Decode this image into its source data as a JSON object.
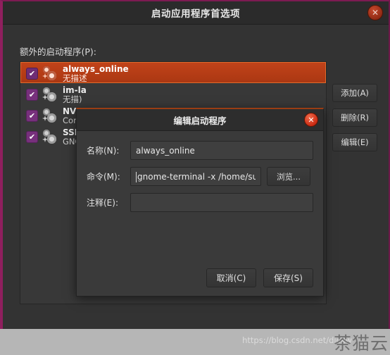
{
  "window": {
    "title": "启动应用程序首选项",
    "close_icon": "close-icon",
    "group_label": "额外的启动程序(P):"
  },
  "startup_list": {
    "items": [
      {
        "name": "always_online",
        "description": "无描述",
        "checked": true,
        "selected": true
      },
      {
        "name": "im-la",
        "description": "无描)",
        "checked": true,
        "selected": false
      },
      {
        "name": "NVID",
        "description": "Confi",
        "checked": true,
        "selected": false
      },
      {
        "name": "SSH",
        "description": "GNO",
        "checked": true,
        "selected": false
      }
    ],
    "check_glyph": "✔"
  },
  "side_buttons": {
    "add": "添加(A)",
    "remove": "删除(R)",
    "edit": "编辑(E)"
  },
  "dialog": {
    "title": "编辑启动程序",
    "close_icon": "close-icon",
    "fields": {
      "name_label": "名称(N):",
      "name_value": "always_online",
      "command_label": "命令(M):",
      "command_value": "gnome-terminal -x /home/su/a",
      "browse_label": "浏览...",
      "comment_label": "注释(E):",
      "comment_value": ""
    },
    "actions": {
      "cancel": "取消(C)",
      "save": "保存(S)"
    }
  },
  "watermarks": {
    "url": "https://blog.csdn.net/dickw",
    "brand": "茶猫云"
  },
  "colors": {
    "selection": "#c2431a",
    "window_border": "#8f1f5e",
    "checkbox": "#77307c",
    "close_red": "#cc2c14"
  }
}
